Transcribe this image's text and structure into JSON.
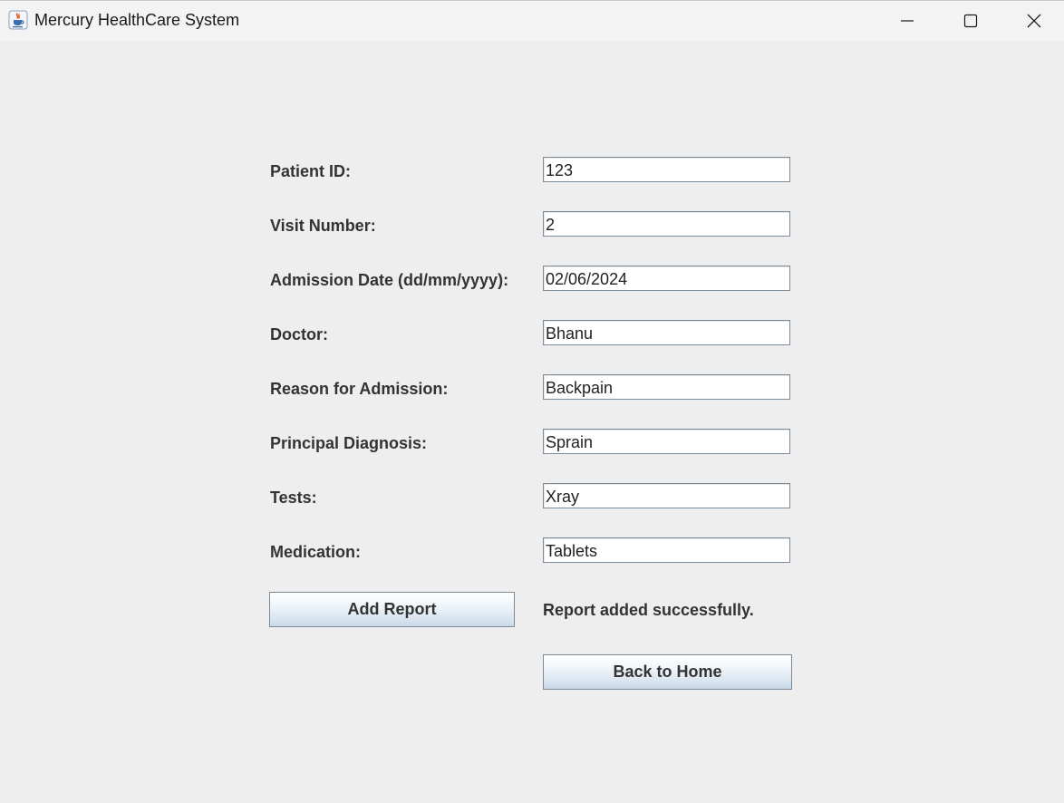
{
  "window": {
    "title": "Mercury HealthCare System",
    "icon": "java-cup-icon",
    "controls": [
      "minimize-icon",
      "maximize-icon",
      "close-icon"
    ]
  },
  "form": {
    "fields": [
      {
        "label": "Patient ID:",
        "value": "123"
      },
      {
        "label": "Visit Number:",
        "value": "2"
      },
      {
        "label": "Admission Date (dd/mm/yyyy):",
        "value": "02/06/2024"
      },
      {
        "label": "Doctor:",
        "value": "Bhanu"
      },
      {
        "label": "Reason for Admission:",
        "value": "Backpain"
      },
      {
        "label": "Principal Diagnosis:",
        "value": "Sprain"
      },
      {
        "label": "Tests:",
        "value": "Xray"
      },
      {
        "label": "Medication:",
        "value": "Tablets"
      }
    ],
    "add_button_label": "Add Report",
    "status_message": "Report added successfully.",
    "back_button_label": "Back to Home"
  },
  "colors": {
    "background": "#eeeeee",
    "titlebar": "#f3f3f3",
    "text": "#333333",
    "field_border": "#7a8a99",
    "button_gradient_bottom": "#c9d8e8"
  }
}
